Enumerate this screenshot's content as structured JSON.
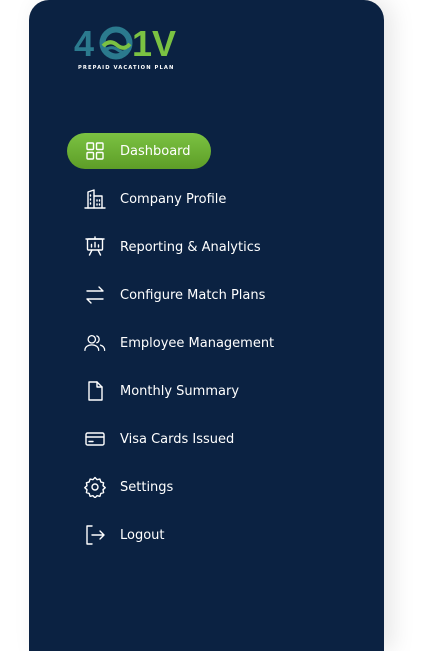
{
  "brand": {
    "logo_text_left": "4",
    "logo_text_right": "1V",
    "tagline": "PREPAID VACATION PLAN",
    "colors": {
      "teal": "#2b7a8e",
      "green": "#7bc242",
      "navy": "#0b2242"
    }
  },
  "sidebar": {
    "items": [
      {
        "label": "Dashboard",
        "icon": "grid-icon",
        "active": true
      },
      {
        "label": "Company Profile",
        "icon": "building-icon",
        "active": false
      },
      {
        "label": "Reporting & Analytics",
        "icon": "presentation-chart-icon",
        "active": false
      },
      {
        "label": "Configure Match Plans",
        "icon": "arrows-swap-icon",
        "active": false
      },
      {
        "label": "Employee Management",
        "icon": "users-icon",
        "active": false
      },
      {
        "label": "Monthly Summary",
        "icon": "document-icon",
        "active": false
      },
      {
        "label": "Visa Cards Issued",
        "icon": "credit-card-icon",
        "active": false
      },
      {
        "label": "Settings",
        "icon": "gear-icon",
        "active": false
      },
      {
        "label": "Logout",
        "icon": "logout-icon",
        "active": false
      }
    ]
  }
}
